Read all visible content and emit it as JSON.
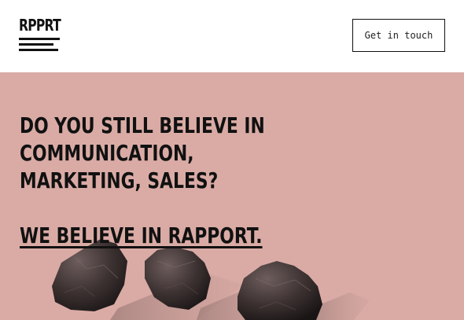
{
  "header": {
    "logo_text": "RPPRT",
    "cta_label": "Get in touch"
  },
  "hero": {
    "headline_lines": [
      "DO YOU STILL BELIEVE IN",
      "COMMUNICATION,",
      "MARKETING, SALES?"
    ],
    "tagline": "WE BELIEVE IN RAPPORT."
  },
  "colors": {
    "hero_background": "#daaba5",
    "text": "#111111",
    "header_background": "#ffffff"
  }
}
